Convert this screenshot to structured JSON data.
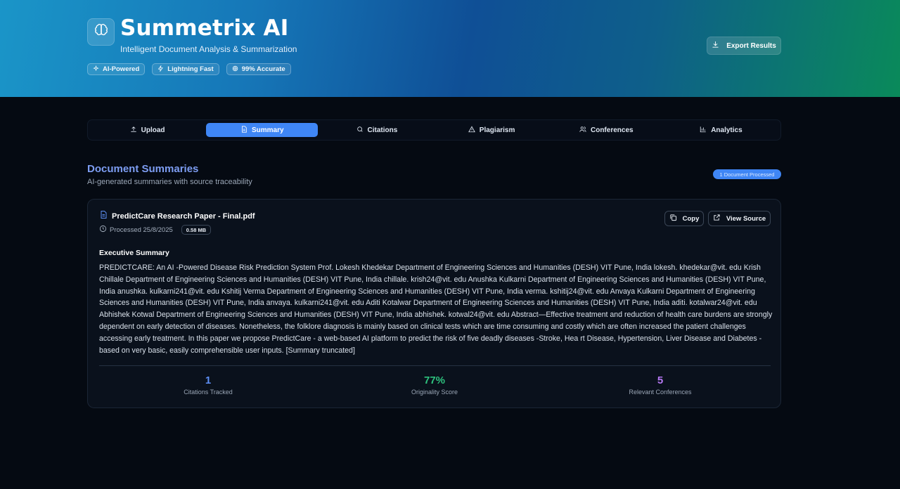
{
  "header": {
    "title": "Summetrix AI",
    "subtitle": "Intelligent Document Analysis & Summarization",
    "badges": [
      {
        "label": "AI-Powered",
        "icon": "sparkle-icon"
      },
      {
        "label": "Lightning Fast",
        "icon": "bolt-icon"
      },
      {
        "label": "99% Accurate",
        "icon": "target-icon"
      }
    ],
    "export_label": "Export Results",
    "logo_icon": "brain-icon"
  },
  "tabs": [
    {
      "label": "Upload",
      "icon": "upload-icon",
      "active": false
    },
    {
      "label": "Summary",
      "icon": "document-icon",
      "active": true
    },
    {
      "label": "Citations",
      "icon": "search-icon",
      "active": false
    },
    {
      "label": "Plagiarism",
      "icon": "warning-icon",
      "active": false
    },
    {
      "label": "Conferences",
      "icon": "users-icon",
      "active": false
    },
    {
      "label": "Analytics",
      "icon": "bar-chart-icon",
      "active": false
    }
  ],
  "section": {
    "title": "Document Summaries",
    "subtitle": "AI-generated summaries with source traceability",
    "processed_count": "1 Document Processed"
  },
  "document": {
    "file_name": "PredictCare Research Paper - Final.pdf",
    "processed": "Processed 25/8/2025",
    "size": "0.58 MB",
    "copy_label": "Copy",
    "view_source_label": "View Source",
    "executive_title": "Executive Summary",
    "summary": "PREDICTCARE: An AI -Powered Disease Risk Prediction System Prof. Lokesh Khedekar Department of Engineering Sciences and Humanities (DESH) VIT Pune, India lokesh. khedekar@vit. edu Krish Chillale Department of Engineering Sciences and Humanities (DESH) VIT Pune, India chillale. krish24@vit. edu Anushka Kulkarni Department of Engineering Sciences and Humanities (DESH) VIT Pune, India anushka. kulkarni241@vit. edu Kshitij Verma Department of Engineering Sciences and Humanities (DESH) VIT Pune, India verma. kshitij24@vit. edu Anvaya Kulkarni Department of Engineering Sciences and Humanities (DESH) VIT Pune, India anvaya. kulkarni241@vit. edu Aditi Kotalwar Department of Engineering Sciences and Humanities (DESH) VIT Pune, India aditi. kotalwar24@vit. edu Abhishek Kotwal Department of Engineering Sciences and Humanities (DESH) VIT Pune, India abhishek. kotwal24@vit. edu Abstract—Effective treatment and reduction of health care burdens are strongly dependent on early detection of diseases. Nonetheless, the folklore diagnosis is mainly based on clinical tests which are time consuming and costly which are often increased the patient challenges accessing early treatment. In this paper we propose PredictCare - a web-based AI platform to predict the risk of five deadly diseases -Stroke, Hea rt Disease, Hypertension, Liver Disease and Diabetes - based on very basic, easily comprehensible user inputs. [Summary truncated]"
  },
  "stats": [
    {
      "value": "1",
      "label": "Citations Tracked",
      "color": "#5d8ff5"
    },
    {
      "value": "77%",
      "label": "Originality Score",
      "color": "#2ec27e"
    },
    {
      "value": "5",
      "label": "Relevant Conferences",
      "color": "#b578f2"
    }
  ],
  "colors": {
    "accent": "#3f86f5",
    "title_accent": "#7d9df2",
    "background": "#050a12"
  }
}
